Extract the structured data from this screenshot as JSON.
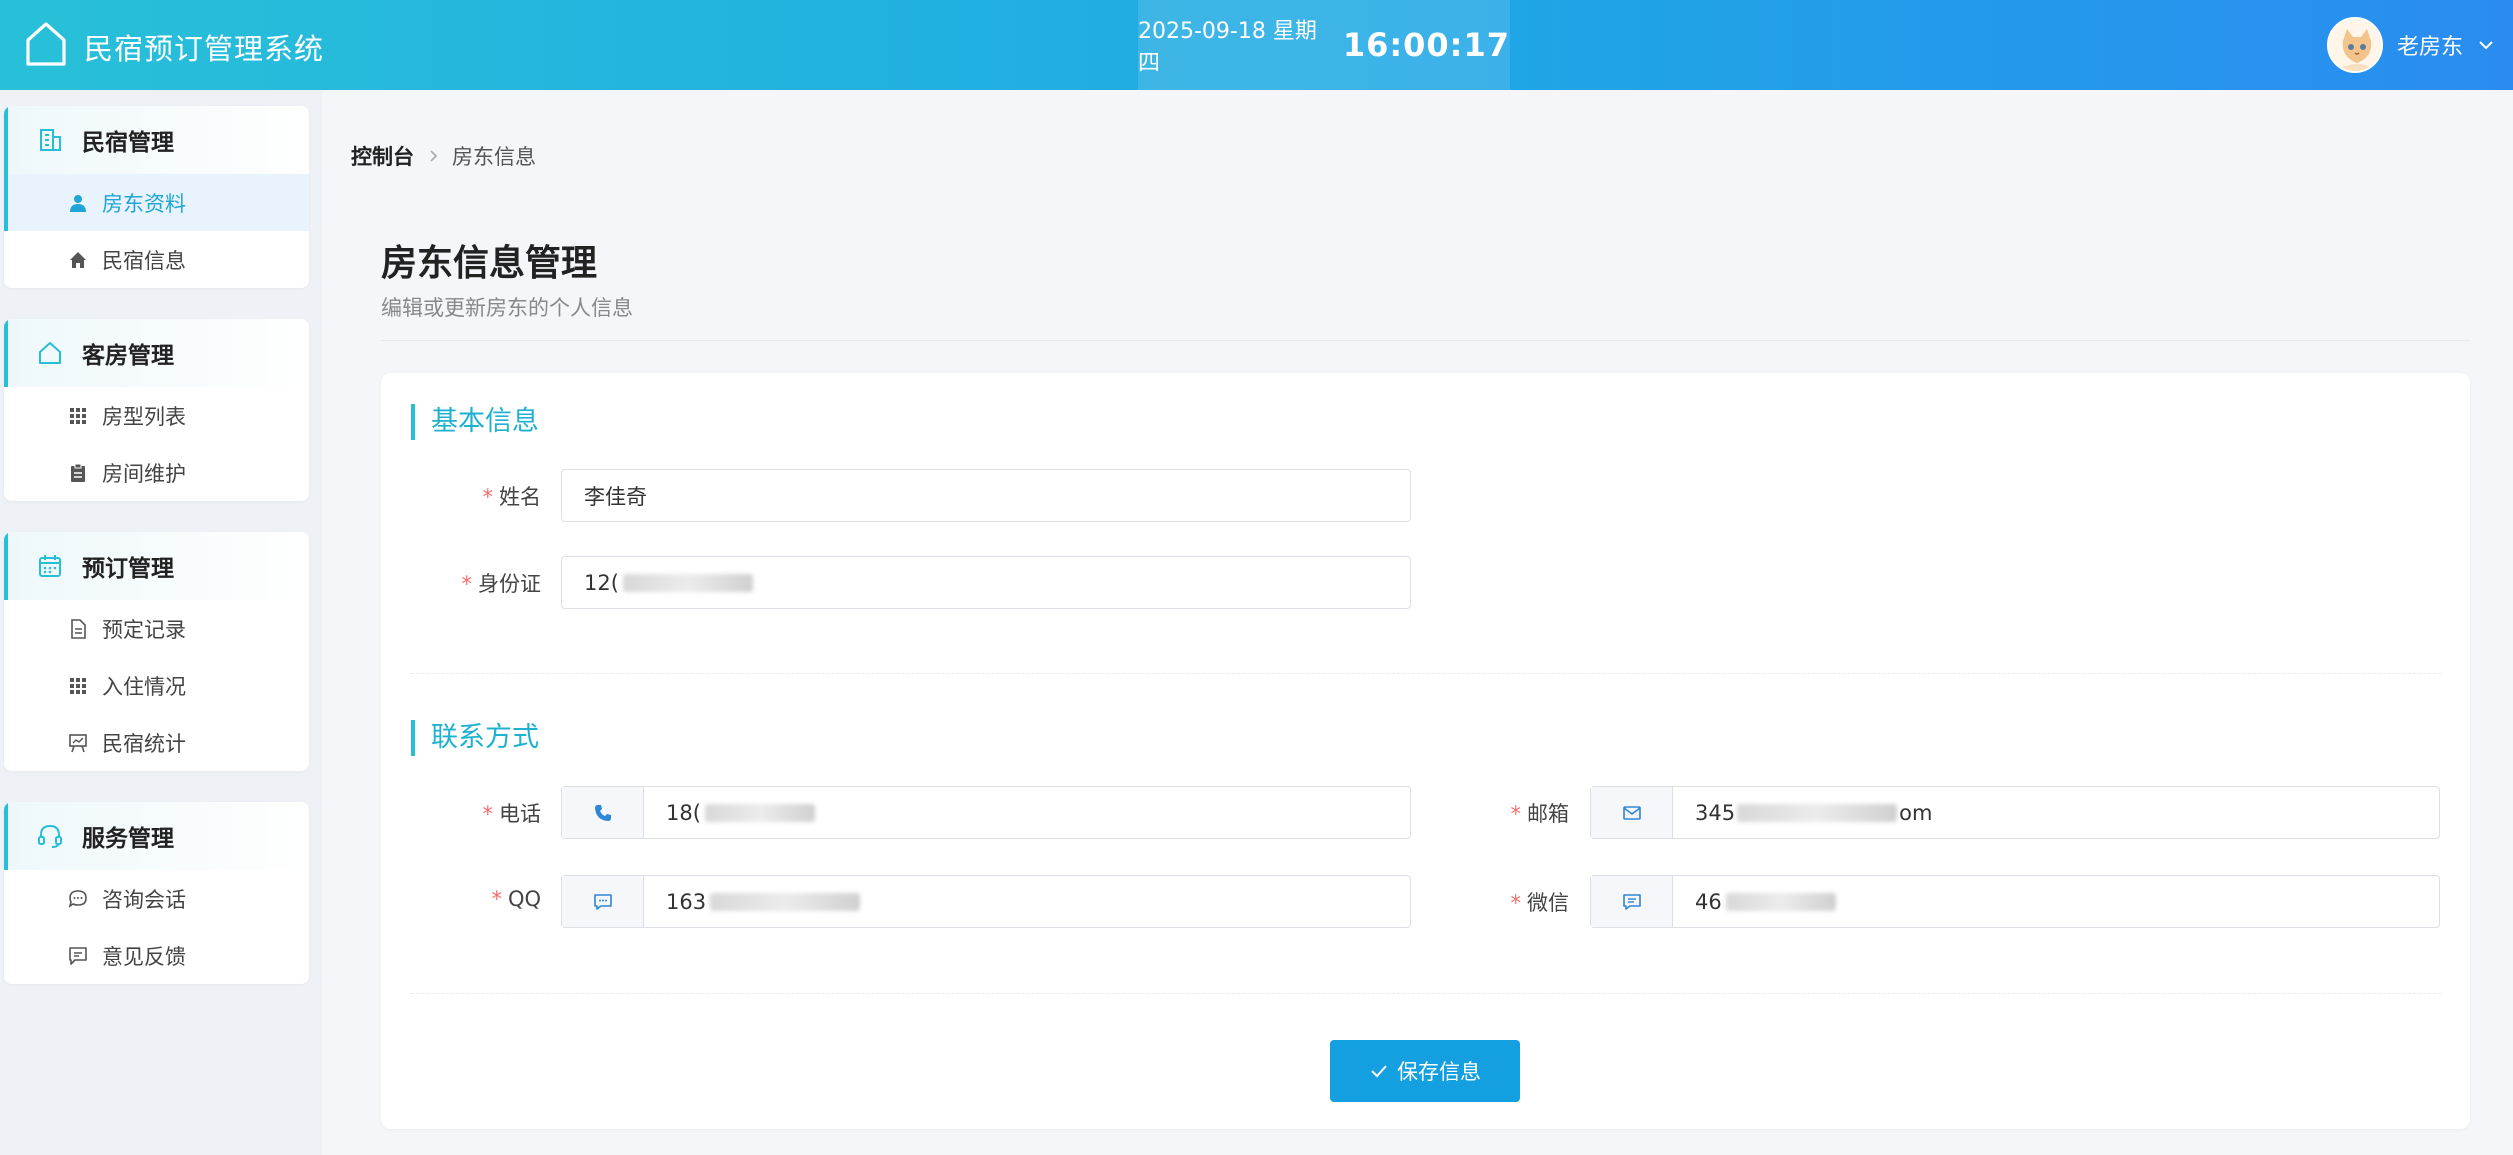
{
  "header": {
    "app_title": "民宿预订管理系统",
    "date": "2025-09-18 星期四",
    "time": "16:00:17",
    "user_name": "老房东"
  },
  "sidebar": {
    "groups": [
      {
        "title": "民宿管理",
        "icon": "building-icon",
        "items": [
          {
            "label": "房东资料",
            "icon": "user-icon",
            "active": true
          },
          {
            "label": "民宿信息",
            "icon": "home-icon",
            "active": false
          }
        ]
      },
      {
        "title": "客房管理",
        "icon": "house-outline-icon",
        "items": [
          {
            "label": "房型列表",
            "icon": "grid-icon",
            "active": false
          },
          {
            "label": "房间维护",
            "icon": "clipboard-icon",
            "active": false
          }
        ]
      },
      {
        "title": "预订管理",
        "icon": "calendar-icon",
        "items": [
          {
            "label": "预定记录",
            "icon": "document-icon",
            "active": false
          },
          {
            "label": "入住情况",
            "icon": "grid-icon",
            "active": false
          },
          {
            "label": "民宿统计",
            "icon": "presentation-icon",
            "active": false
          }
        ]
      },
      {
        "title": "服务管理",
        "icon": "headset-icon",
        "items": [
          {
            "label": "咨询会话",
            "icon": "chat-bubble-icon",
            "active": false
          },
          {
            "label": "意见反馈",
            "icon": "message-square-icon",
            "active": false
          }
        ]
      }
    ]
  },
  "breadcrumb": {
    "home": "控制台",
    "current": "房东信息"
  },
  "page": {
    "title": "房东信息管理",
    "subtitle": "编辑或更新房东的个人信息"
  },
  "form": {
    "basic_section": "基本信息",
    "contact_section": "联系方式",
    "name": {
      "label": "姓名",
      "value": "李佳奇"
    },
    "id_card": {
      "label": "身份证",
      "value": "12("
    },
    "phone": {
      "label": "电话",
      "value": "18("
    },
    "email": {
      "label": "邮箱",
      "value_start": "345",
      "value_end": "om"
    },
    "qq": {
      "label": "QQ",
      "value": "163"
    },
    "wechat": {
      "label": "微信",
      "value": "46"
    },
    "save_label": "保存信息"
  },
  "colors": {
    "accent": "#27bfd7",
    "primary_button": "#139fe0",
    "required": "#f56c6c"
  }
}
